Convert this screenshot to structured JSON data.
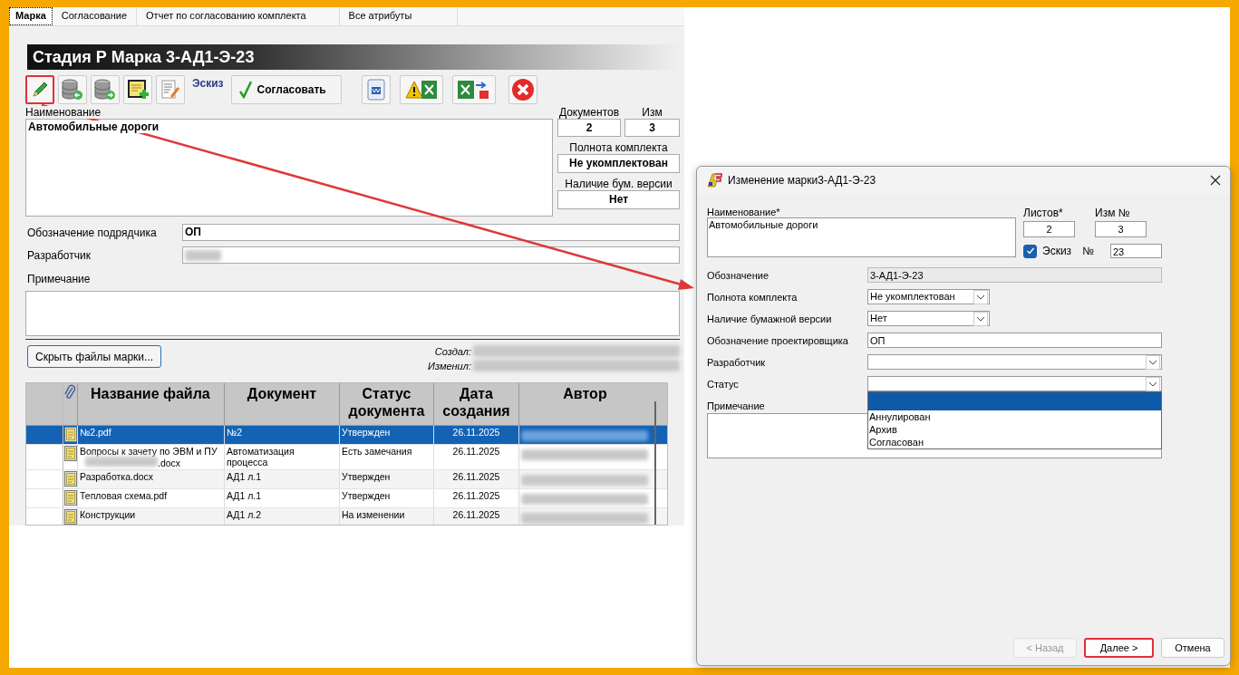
{
  "tabs": [
    {
      "label": "Марка",
      "selected": true
    },
    {
      "label": "Согласование",
      "selected": false
    },
    {
      "label": "Отчет по согласованию комплекта",
      "selected": false
    },
    {
      "label": "Все атрибуты",
      "selected": false
    }
  ],
  "header": {
    "title": "Стадия Р Марка 3-АД1-Э-23"
  },
  "toolbar": [
    {
      "kind": "pencil",
      "highlighted": true
    },
    {
      "kind": "db-back",
      "highlighted": false
    },
    {
      "kind": "db-forward",
      "highlighted": false
    },
    {
      "kind": "note-add",
      "highlighted": false
    },
    {
      "kind": "doc-edit",
      "highlighted": false
    },
    {
      "kind": "label",
      "text": "Эскиз",
      "highlighted": false
    },
    {
      "kind": "text-button",
      "text": "Согласовать",
      "highlighted": false
    },
    {
      "kind": "word",
      "highlighted": false
    },
    {
      "kind": "warn-excel",
      "highlighted": false
    },
    {
      "kind": "excel-export",
      "highlighted": false
    },
    {
      "kind": "close",
      "highlighted": false
    }
  ],
  "summary": {
    "name_label": "Наименование",
    "name_value": "Автомобильные дороги",
    "docs_label": "Документов",
    "docs_value": "2",
    "rev_label": "Изм",
    "rev_value": "3",
    "completeness_label": "Полнота комплекта",
    "completeness_value": "Не укомплектован",
    "paper_label": "Наличие бум. версии",
    "paper_value": "Нет"
  },
  "fields": [
    {
      "label": "Обозначение подрядчика",
      "value": "ОП",
      "redacted": false
    },
    {
      "label": "Разработчик",
      "redacted": true
    }
  ],
  "note": {
    "label": "Примечание"
  },
  "hide_files_button": "Скрыть файлы марки...",
  "audit": [
    {
      "label": "Создал:"
    },
    {
      "label": "Изменил:"
    }
  ],
  "files": {
    "columns": [
      "Название файла",
      "Документ",
      "Статус документа",
      "Дата создания",
      "Автор"
    ],
    "rows": [
      {
        "selected": true,
        "name": "№2.pdf",
        "document": "№2",
        "status": "Утвержден",
        "date": "26.11.2025"
      },
      {
        "selected": false,
        "name": "Вопросы к зачету по ЭВМ и ПУ",
        "name_end": ".docx",
        "document": "Автоматизация процесса",
        "status": "Есть замечания",
        "date": "26.11.2025"
      },
      {
        "selected": false,
        "name": "Разработка.docx",
        "document": "АД1 л.1",
        "status": "Утвержден",
        "date": "26.11.2025"
      },
      {
        "selected": false,
        "name": "Тепловая схема.pdf",
        "document": "АД1 л.1",
        "status": "Утвержден",
        "date": "26.11.2025"
      },
      {
        "selected": false,
        "name": "Конструкции",
        "document": "АД1 л.2",
        "status": "На изменении",
        "date": "26.11.2025"
      }
    ]
  },
  "dialog": {
    "title": "Изменение марки3-АД1-Э-23",
    "name_label": "Наименование*",
    "name_value": "Автомобильные дороги",
    "sheets_label": "Листов*",
    "sheets_value": "2",
    "rev_label": "Изм №",
    "rev_value": "3",
    "sketch": {
      "label": "Эскиз",
      "checked": true
    },
    "number_label": "№",
    "number_value": "23",
    "fields": [
      {
        "kind": "readonly",
        "label": "Обозначение",
        "value": "3-АД1-Э-23"
      },
      {
        "kind": "combo-short",
        "label": "Полнота комплекта",
        "value": "Не укомплектован"
      },
      {
        "kind": "combo-short",
        "label": "Наличие бумажной версии",
        "value": "Нет"
      },
      {
        "kind": "text",
        "label": "Обозначение проектировщика",
        "value": "ОП"
      },
      {
        "kind": "combo",
        "label": "Разработчик"
      },
      {
        "kind": "combo",
        "label": "Статус",
        "expanded": true
      }
    ],
    "status_list": {
      "blank_selected": true,
      "options": [
        {
          "label": "Аннулирован",
          "selected": false
        },
        {
          "label": "Архив",
          "selected": false
        },
        {
          "label": "Согласован",
          "selected": false
        }
      ]
    },
    "note_label": "Примечание",
    "buttons": [
      {
        "label": "< Назад",
        "disabled": true,
        "highlighted": false
      },
      {
        "label": "Далее >",
        "disabled": false,
        "highlighted": true
      },
      {
        "label": "Отмена",
        "disabled": false,
        "highlighted": false
      }
    ]
  }
}
